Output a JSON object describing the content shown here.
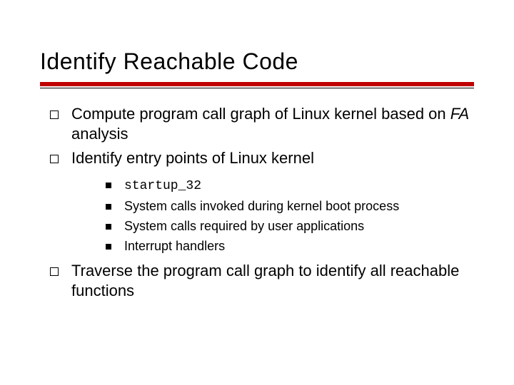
{
  "title": "Identify Reachable Code",
  "bullets": [
    {
      "pre": "Compute program call graph of Linux kernel based on ",
      "em": "FA",
      "post": " analysis"
    },
    {
      "text": "Identify entry points of Linux kernel"
    },
    {
      "text": "Traverse the program call graph to identify all reachable functions"
    }
  ],
  "sub": {
    "code": "startup_32",
    "items": [
      "System calls invoked during kernel boot process",
      "System calls required by user applications",
      "Interrupt handlers"
    ]
  }
}
